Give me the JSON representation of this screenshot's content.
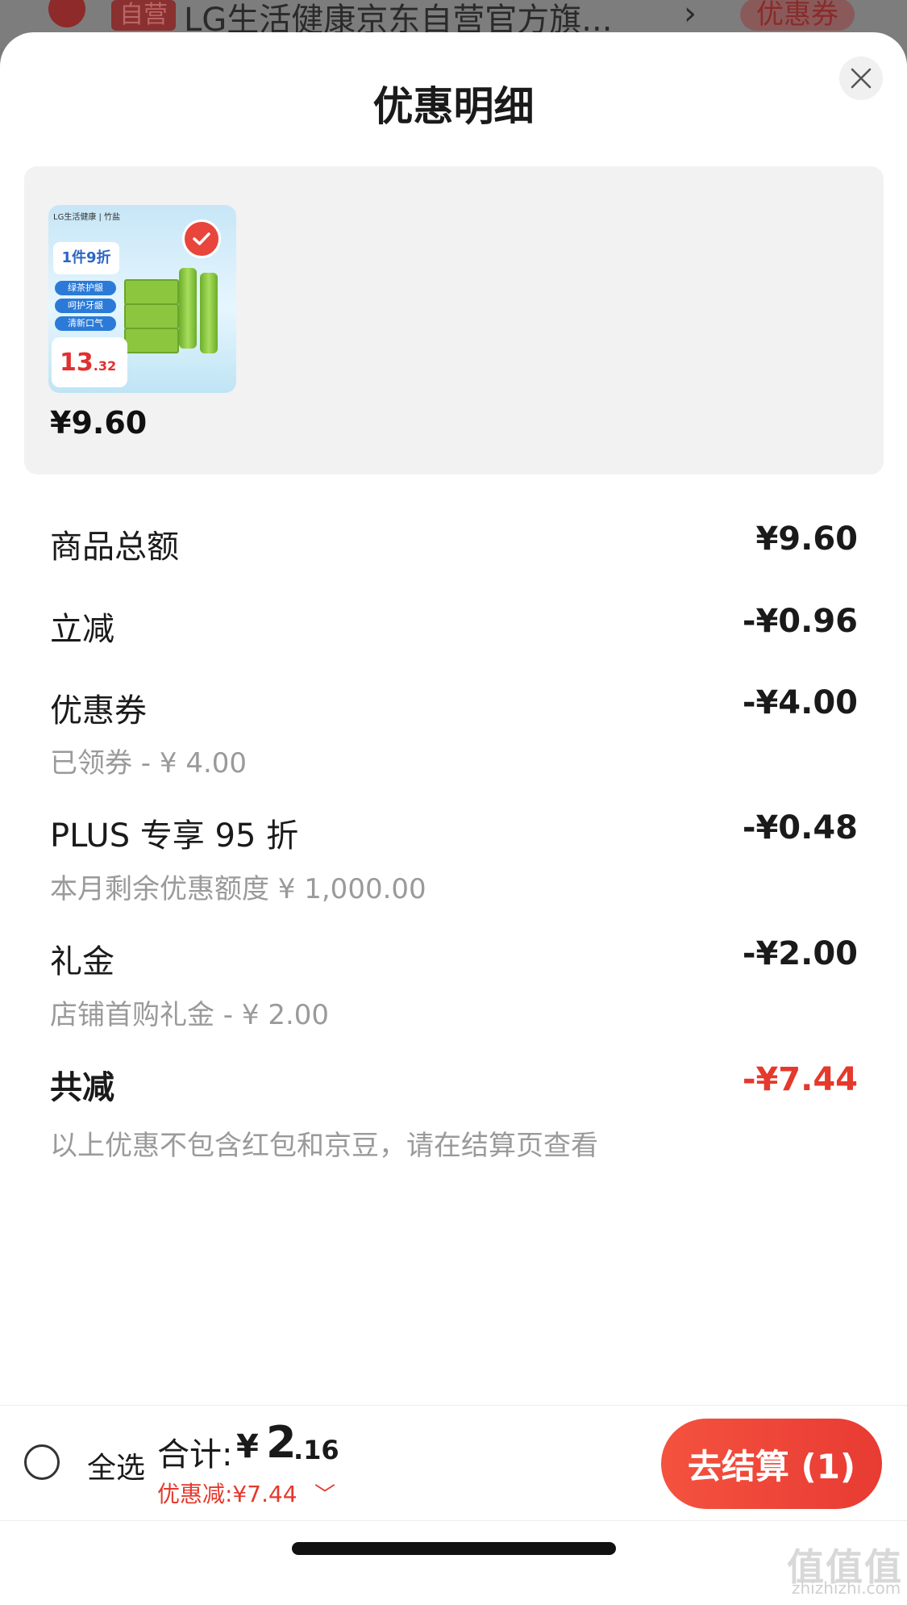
{
  "background": {
    "badge": "自营",
    "store_name": "LG生活健康京东自营官方旗...",
    "chevron": "›",
    "coupon_label": "优惠券"
  },
  "modal": {
    "title": "优惠明细",
    "close_icon": "close-icon"
  },
  "product": {
    "price": "¥9.60",
    "thumbnail": {
      "brand": "LG生活健康 | 竹盐",
      "promo": "1件9折",
      "chips": [
        "绿茶护龈",
        "呵护牙龈",
        "清新口气"
      ],
      "price_int": "13",
      "price_dec": ".32"
    }
  },
  "breakdown": [
    {
      "label": "商品总额",
      "value": "¥9.60",
      "sub": ""
    },
    {
      "label": "立减",
      "value": "-¥0.96",
      "sub": ""
    },
    {
      "label": "优惠券",
      "value": "-¥4.00",
      "sub": "已领券 - ¥ 4.00"
    },
    {
      "label": "PLUS 专享 95 折",
      "value": "-¥0.48",
      "sub": "本月剩余优惠额度  ¥ 1,000.00"
    },
    {
      "label": "礼金",
      "value": "-¥2.00",
      "sub": "店铺首购礼金 - ¥ 2.00"
    },
    {
      "label": "共减",
      "value": "-¥7.44",
      "sub": "以上优惠不包含红包和京豆，请在结算页查看"
    }
  ],
  "bottom_bar": {
    "select_all": "全选",
    "total_label": "合计:",
    "total_yen": "¥",
    "total_int": "2",
    "total_dec": ".16",
    "discount_label": "优惠减:¥7.44",
    "discount_chevron": "﹀",
    "checkout_label": "去结算 (1)"
  },
  "watermark": {
    "text": "值值值",
    "sub": "zhizhizhi.com"
  },
  "colors": {
    "accent": "#e4392c",
    "checkout_gradient_start": "#f4523f",
    "checkout_gradient_end": "#e83b33"
  }
}
